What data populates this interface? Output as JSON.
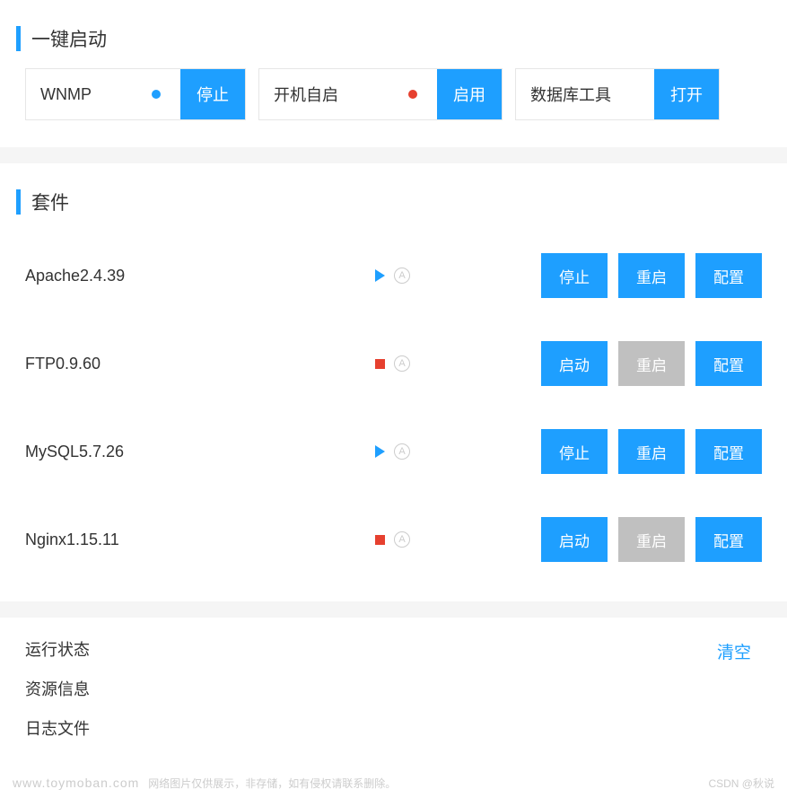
{
  "sections": {
    "quick_start": {
      "title": "一键启动",
      "wnmp": {
        "label": "WNMP",
        "status_color": "#1e9fff",
        "button": "停止"
      },
      "autostart": {
        "label": "开机自启",
        "status_color": "#e6402f",
        "button": "启用"
      },
      "dbtool": {
        "label": "数据库工具",
        "button": "打开"
      }
    },
    "suite": {
      "title": "套件",
      "services": [
        {
          "name": "Apache2.4.39",
          "running": true,
          "btn1": "停止",
          "btn1_state": "primary",
          "btn2": "重启",
          "btn2_state": "primary",
          "btn3": "配置",
          "btn3_state": "primary"
        },
        {
          "name": "FTP0.9.60",
          "running": false,
          "btn1": "启动",
          "btn1_state": "primary",
          "btn2": "重启",
          "btn2_state": "disabled",
          "btn3": "配置",
          "btn3_state": "primary"
        },
        {
          "name": "MySQL5.7.26",
          "running": true,
          "btn1": "停止",
          "btn1_state": "primary",
          "btn2": "重启",
          "btn2_state": "primary",
          "btn3": "配置",
          "btn3_state": "primary"
        },
        {
          "name": "Nginx1.15.11",
          "running": false,
          "btn1": "启动",
          "btn1_state": "primary",
          "btn2": "重启",
          "btn2_state": "disabled",
          "btn3": "配置",
          "btn3_state": "primary"
        }
      ],
      "circle_label": "A"
    },
    "bottom": {
      "tabs": [
        "运行状态",
        "资源信息",
        "日志文件"
      ],
      "clear": "清空"
    }
  },
  "footer": {
    "domain": "www.toymoban.com",
    "notice": "网络图片仅供展示，非存储，如有侵权请联系删除。",
    "credit": "CSDN @秋说"
  }
}
